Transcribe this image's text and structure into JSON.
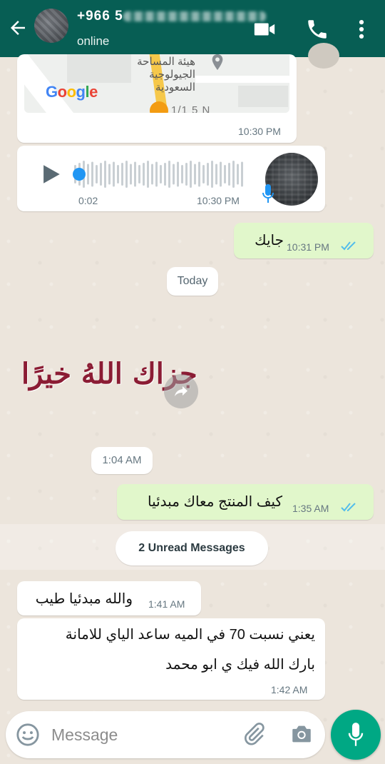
{
  "header": {
    "contact_name": "+966 5",
    "status": "online"
  },
  "map": {
    "place_label_line1": "هيئة المساحة",
    "place_label_line2": "الجيولوجية السعودية",
    "google_letters": [
      "G",
      "o",
      "o",
      "g",
      "l",
      "e"
    ],
    "google_colors": [
      "#4285f4",
      "#ea4335",
      "#fbbc05",
      "#4285f4",
      "#34a853",
      "#ea4335"
    ],
    "road_label": "1/1 5 N",
    "time": "10:30 PM"
  },
  "voice_note": {
    "duration": "0:02",
    "time": "10:30 PM"
  },
  "messages": [
    {
      "text": "جايك",
      "time": "10:31 PM",
      "direction": "out"
    },
    {
      "text": "كيف المنتج معاك مبدئيا",
      "time": "1:35 AM",
      "direction": "out"
    },
    {
      "text": "والله مبدئيا طيب",
      "time": "1:41 AM",
      "direction": "in"
    },
    {
      "line1": "يعني نسبت 70 في الميه ساعد الياي للامانة",
      "line2": "بارك الله فيك ي ابو محمد",
      "time": "1:42 AM",
      "direction": "in"
    }
  ],
  "date_divider": "Today",
  "sticker": {
    "text": "جزاك اللهُ خيرًا",
    "time": "1:04 AM"
  },
  "unread_banner": "2 Unread Messages",
  "input": {
    "placeholder": "Message"
  },
  "colors": {
    "header": "#075e54",
    "outgoing_bubble": "#e1f7cb",
    "read_ticks": "#53bdeb",
    "send_button": "#00a884"
  }
}
